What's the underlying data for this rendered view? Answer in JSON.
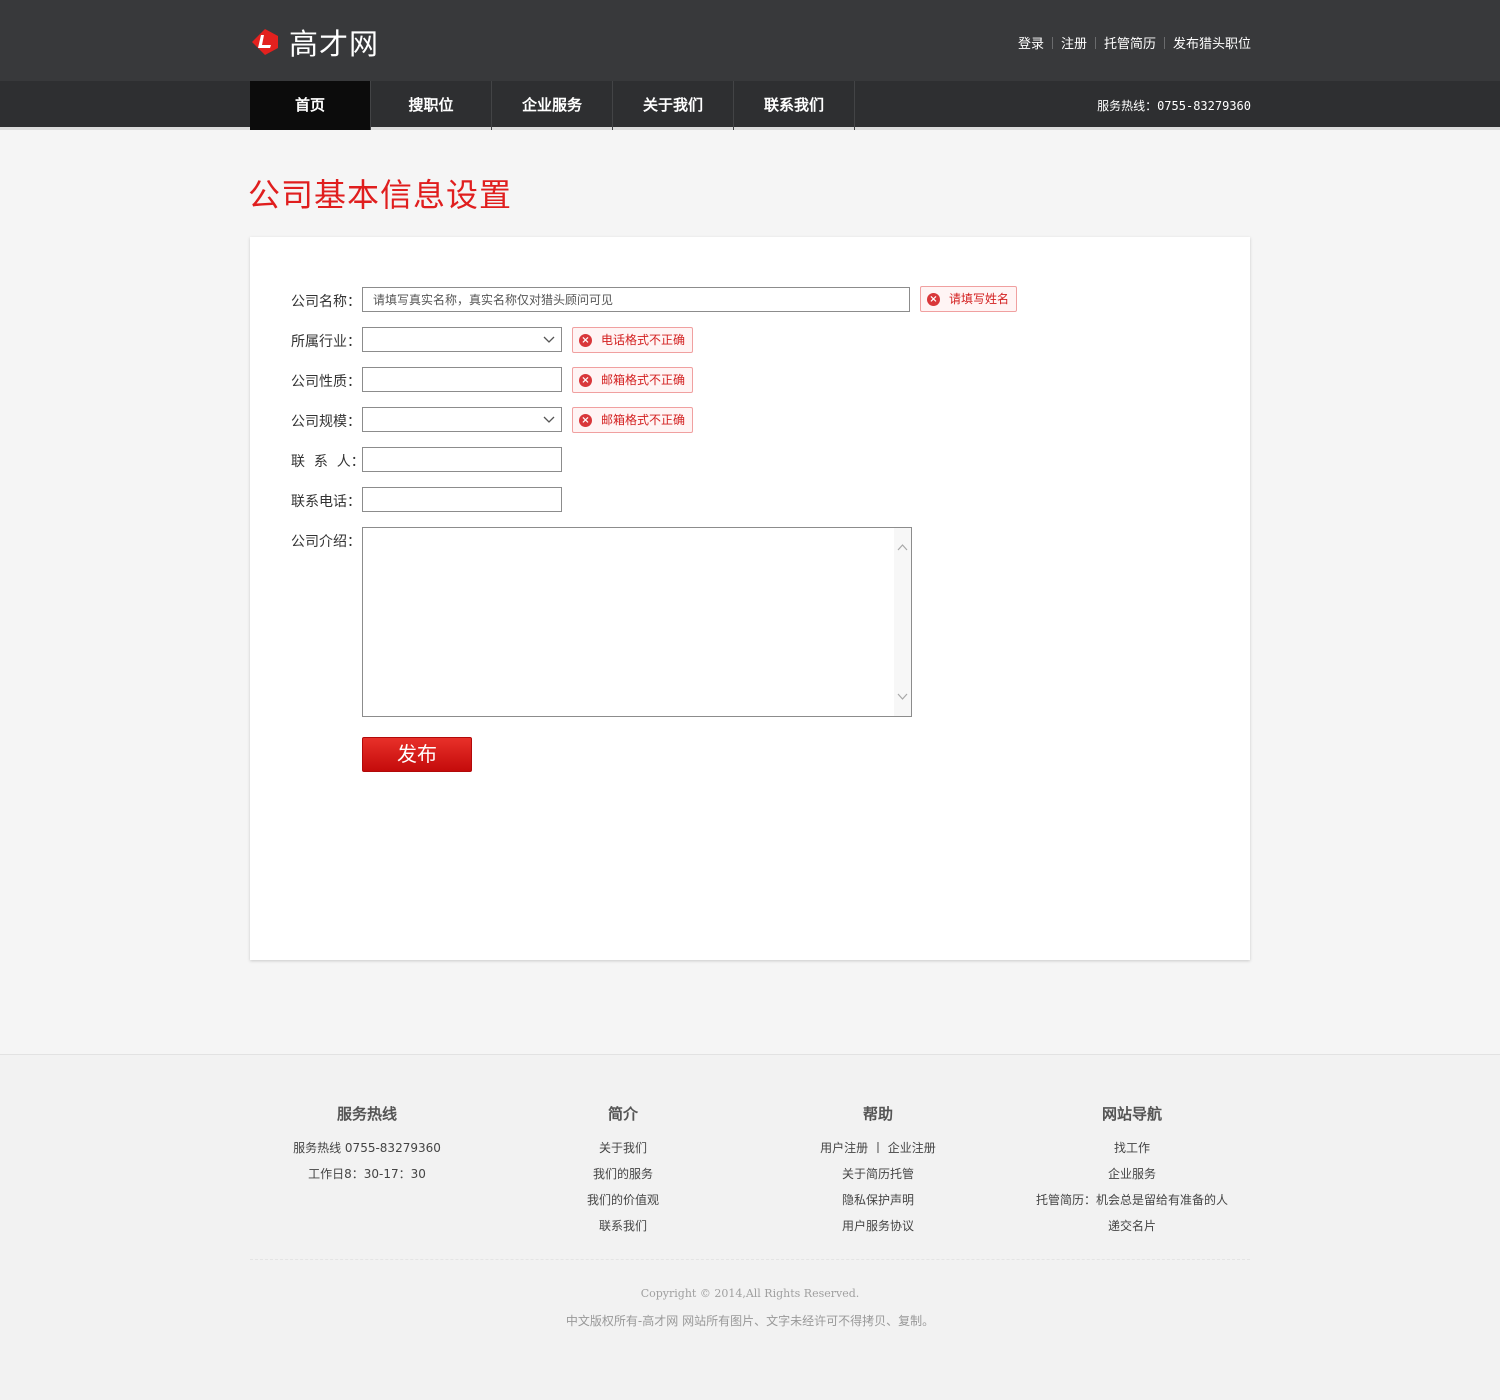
{
  "brand": {
    "name": "高才网"
  },
  "top_links": [
    "登录",
    "注册",
    "托管简历",
    "发布猎头职位"
  ],
  "nav": {
    "items": [
      "首页",
      "搜职位",
      "企业服务",
      "关于我们",
      "联系我们"
    ],
    "hotline": "服务热线：0755-83279360"
  },
  "page_title": "公司基本信息设置",
  "form": {
    "company_name": {
      "label": "公司名称：",
      "placeholder": "请填写真实名称，真实名称仅对猎头顾问可见",
      "error": "请填写姓名"
    },
    "industry": {
      "label": "所属行业：",
      "value": "",
      "error": "电话格式不正确"
    },
    "nature": {
      "label": "公司性质：",
      "value": "",
      "error": "邮箱格式不正确"
    },
    "scale": {
      "label": "公司规模：",
      "value": "",
      "error": "邮箱格式不正确"
    },
    "contact": {
      "label": "联  系  人：",
      "value": ""
    },
    "phone": {
      "label": "联系电话：",
      "value": ""
    },
    "intro": {
      "label": "公司介绍：",
      "value": ""
    },
    "submit_label": "发布"
  },
  "footer": {
    "cols": [
      {
        "title": "服务热线",
        "lines": [
          "服务热线 0755-83279360",
          "工作日8：30-17：30"
        ]
      },
      {
        "title": "简介",
        "lines": [
          "关于我们",
          "我们的服务",
          "我们的价值观",
          "联系我们"
        ]
      },
      {
        "title": "帮助",
        "lines": [
          "用户注册 丨 企业注册",
          "关于简历托管",
          "隐私保护声明",
          "用户服务协议"
        ]
      },
      {
        "title": "网站导航",
        "lines": [
          "找工作",
          "企业服务",
          "托管简历：机会总是留给有准备的人",
          "递交名片"
        ]
      }
    ],
    "copyright": "Copyright © 2014,All Rights Reserved.",
    "notice": "中文版权所有-高才网 网站所有图片、文字未经许可不得拷贝、复制。"
  },
  "colors": {
    "accent": "#e01e1e",
    "header_bg": "#38393b",
    "nav_bg": "#2e2f31"
  }
}
